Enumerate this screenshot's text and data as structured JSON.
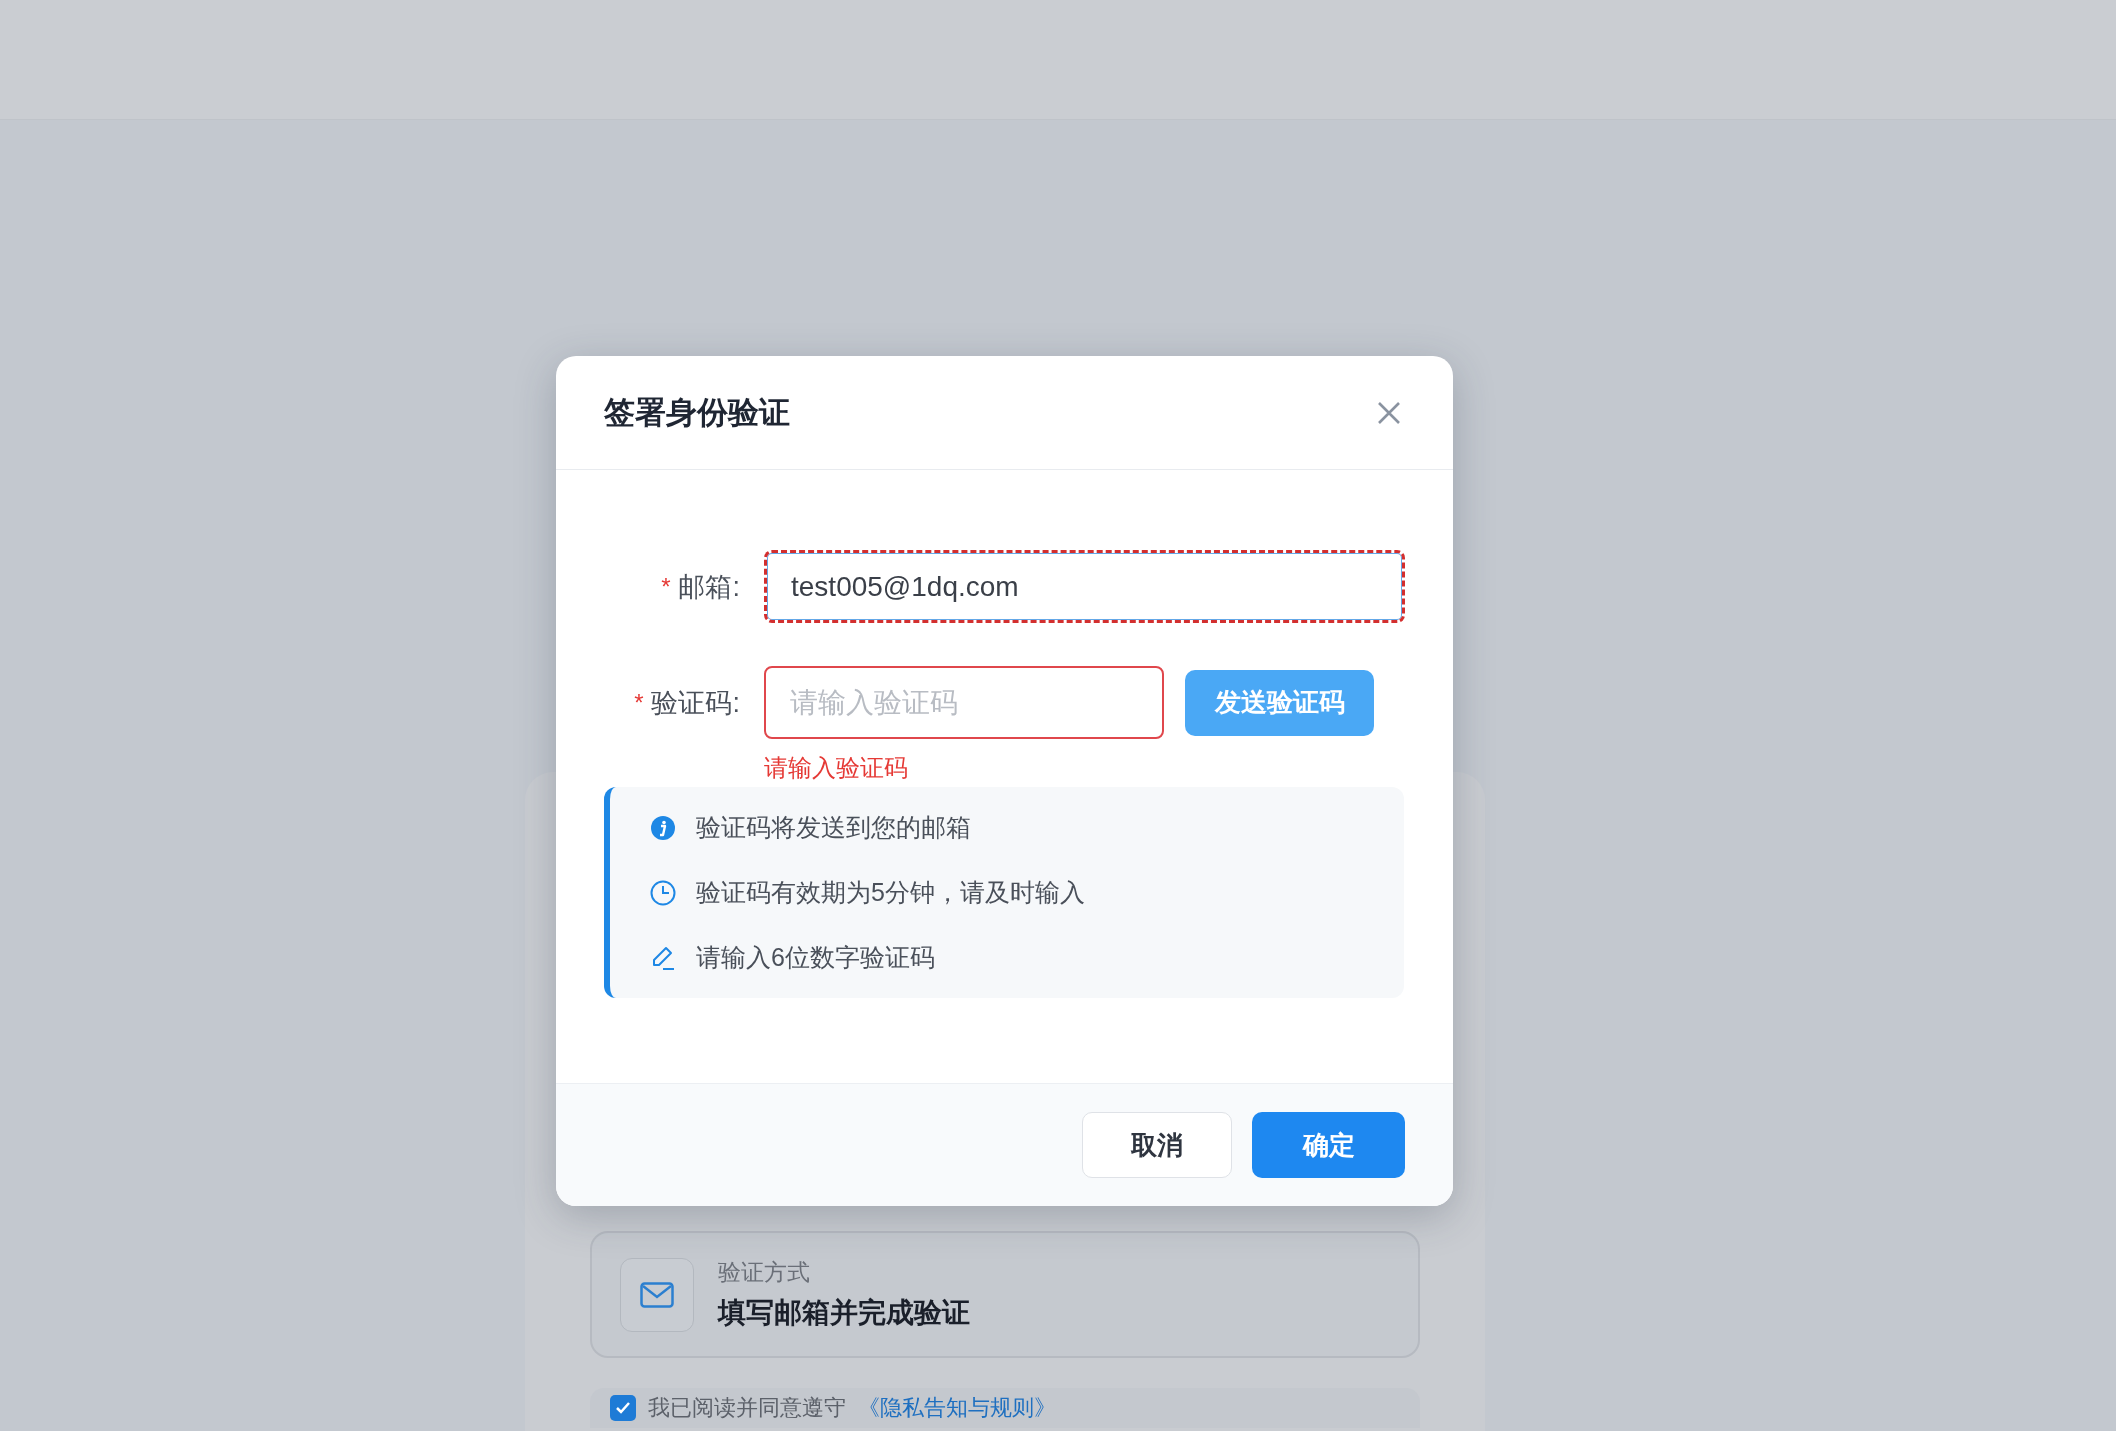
{
  "dialog": {
    "title": "签署身份验证",
    "fields": [
      {
        "mark": "*",
        "label": "邮箱:",
        "value": "test005@1dq.com",
        "focused": true,
        "invalid": false
      },
      {
        "mark": "*",
        "label": "验证码:",
        "placeholder": "请输入验证码",
        "focused": false,
        "invalid": true,
        "error": "请输入验证码",
        "button": "发送验证码"
      }
    ],
    "tips": [
      {
        "kind": "info",
        "text": "验证码将发送到您的邮箱"
      },
      {
        "kind": "clock",
        "text": "验证码有效期为5分钟，请及时输入"
      },
      {
        "kind": "edit",
        "text": "请输入6位数字验证码"
      }
    ],
    "buttons": [
      {
        "kind": "secondary",
        "label": "取消"
      },
      {
        "kind": "primary",
        "label": "确定"
      }
    ]
  },
  "background": {
    "method_card": {
      "label": "验证方式",
      "value": "填写邮箱并完成验证"
    },
    "agreement": {
      "checked": true,
      "text": "我已阅读并同意遵守",
      "link": "《隐私告知与规则》"
    }
  }
}
